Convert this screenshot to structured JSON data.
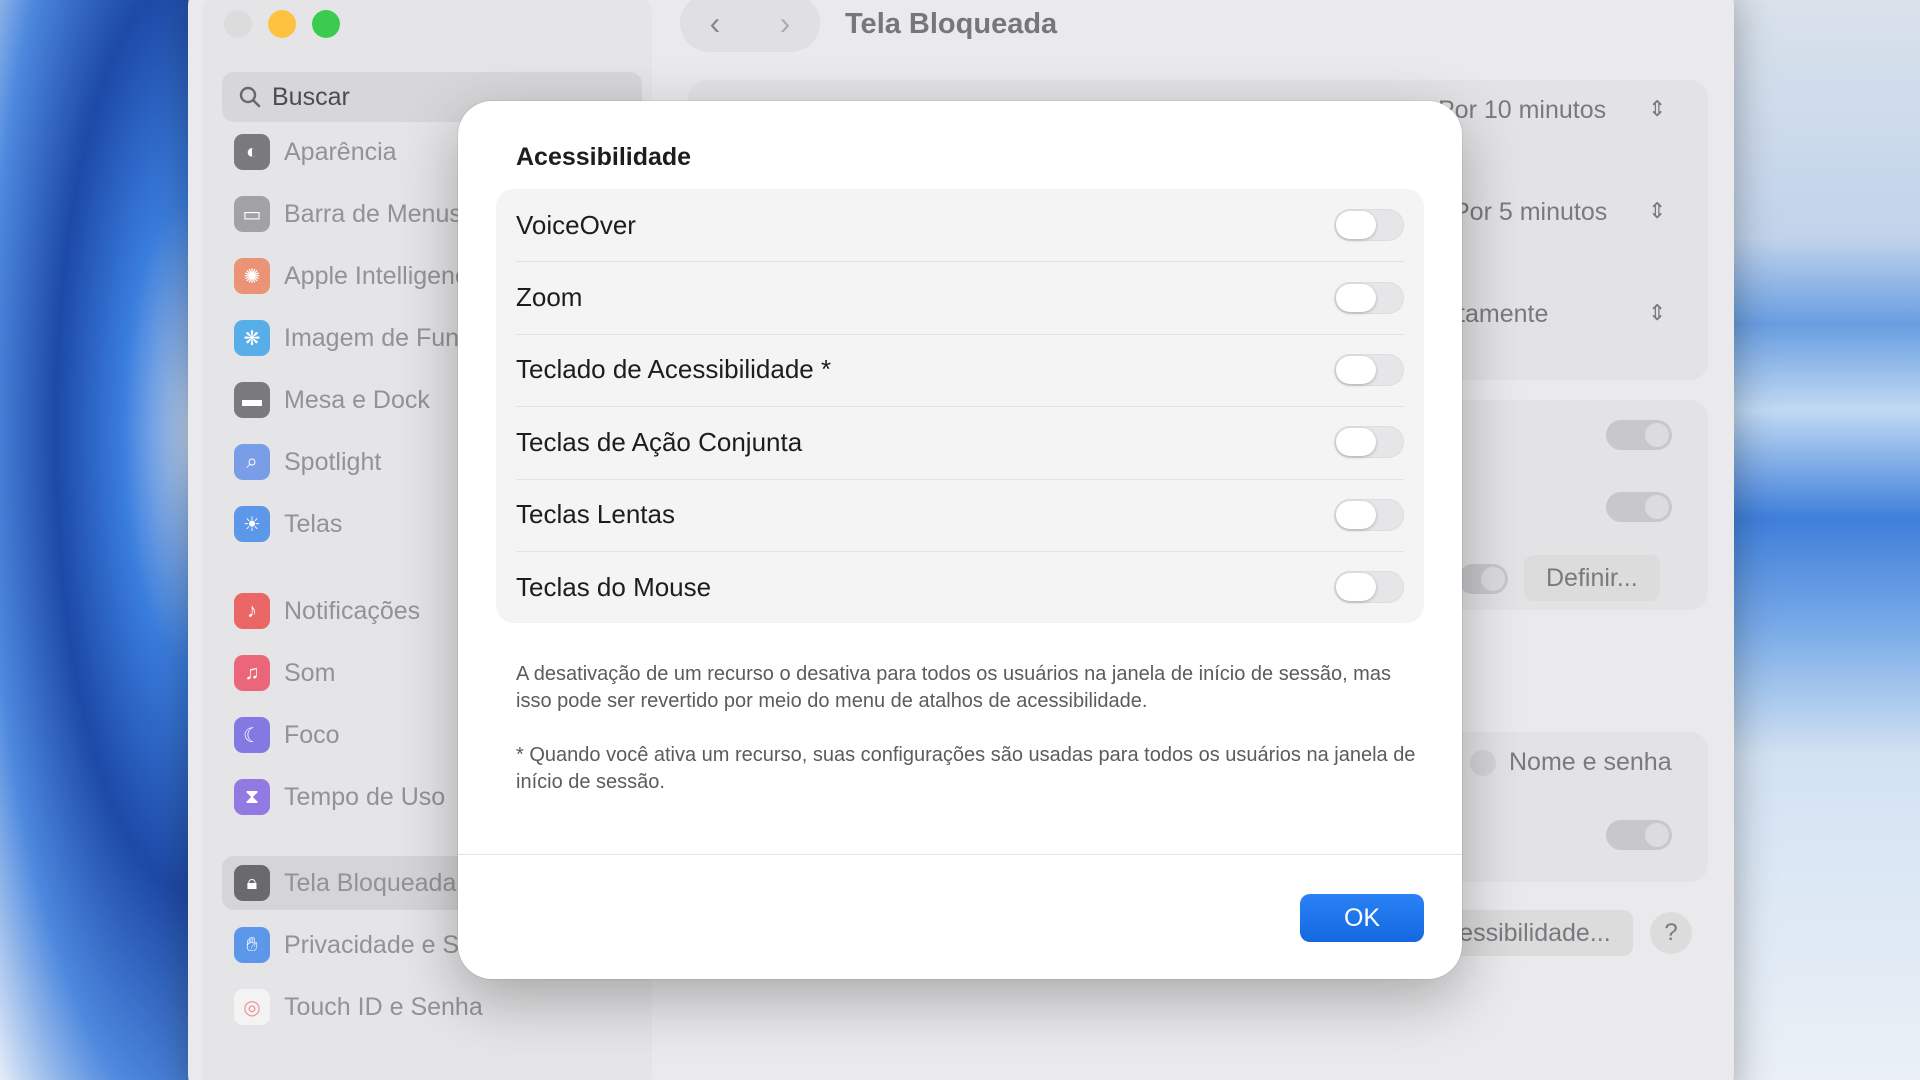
{
  "window": {
    "title": "Tela Bloqueada",
    "back_glyph": "‹",
    "forward_glyph": "›"
  },
  "sidebar": {
    "search_placeholder": "Buscar",
    "items": [
      {
        "label": "Aparência",
        "icon": "appearance-icon",
        "color": "#6e6e73"
      },
      {
        "label": "Barra de Menus",
        "icon": "menu-bar-icon",
        "color": "#8e8e93"
      },
      {
        "label": "Apple Intelligence e Siri",
        "icon": "apple-intelligence-icon",
        "color": "#e98a6b"
      },
      {
        "label": "Imagem de Fundo",
        "icon": "wallpaper-icon",
        "color": "#4aa8e8"
      },
      {
        "label": "Mesa e Dock",
        "icon": "dock-icon",
        "color": "#6e6e73"
      },
      {
        "label": "Spotlight",
        "icon": "spotlight-icon",
        "color": "#6f95e6"
      },
      {
        "label": "Telas",
        "icon": "displays-icon",
        "color": "#4f8fe8"
      },
      {
        "label": "Notificações",
        "icon": "notifications-icon",
        "color": "#ea5a5a"
      },
      {
        "label": "Som",
        "icon": "sound-icon",
        "color": "#ea5a6e"
      },
      {
        "label": "Foco",
        "icon": "focus-icon",
        "color": "#7a6ee0"
      },
      {
        "label": "Tempo de Uso",
        "icon": "screen-time-icon",
        "color": "#8a6ee0"
      },
      {
        "label": "Tela Bloqueada",
        "icon": "lock-icon",
        "color": "#5d5d62"
      },
      {
        "label": "Privacidade e Segurança",
        "icon": "privacy-hand-icon",
        "color": "#4f8fe8"
      },
      {
        "label": "Touch ID e Senha",
        "icon": "fingerprint-icon",
        "color": "#f2f2f4"
      }
    ]
  },
  "background": {
    "row1_value": "Por 10 minutos",
    "row2_value": "Por 5 minutos",
    "row3_value": "Imediatamente",
    "define_button": "Definir...",
    "login_option": "Nome e senha",
    "accessibility_button": "Acessibilidade...",
    "help_label": "?"
  },
  "modal": {
    "title": "Acessibilidade",
    "options": [
      {
        "label": "VoiceOver",
        "enabled": false
      },
      {
        "label": "Zoom",
        "enabled": false
      },
      {
        "label": "Teclado de Acessibilidade *",
        "enabled": false
      },
      {
        "label": "Teclas de Ação Conjunta",
        "enabled": false
      },
      {
        "label": "Teclas Lentas",
        "enabled": false
      },
      {
        "label": "Teclas do Mouse",
        "enabled": false
      }
    ],
    "note1": "A desativação de um recurso o desativa para todos os usuários na janela de início de sessão, mas isso pode ser revertido por meio do menu de atalhos de acessibilidade.",
    "note2": "* Quando você ativa um recurso, suas configurações são usadas para todos os usuários na janela de início de sessão.",
    "ok_label": "OK",
    "accent_color": "#1a73e8"
  }
}
